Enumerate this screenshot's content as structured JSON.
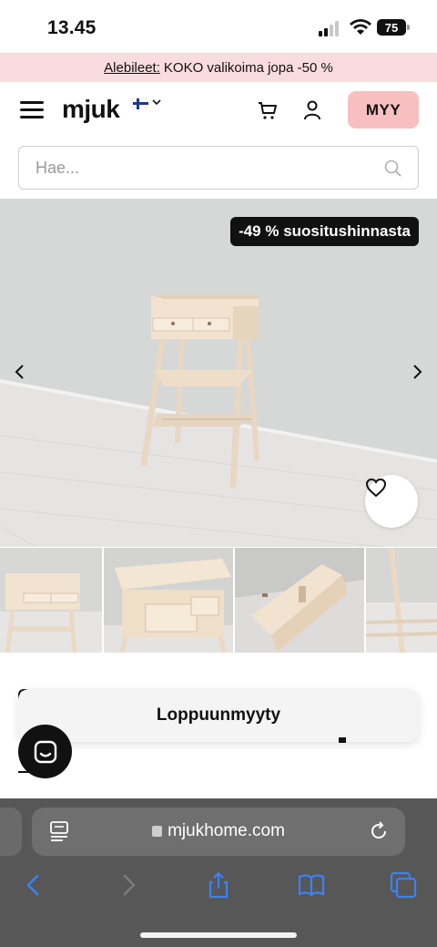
{
  "status_bar": {
    "time": "13.45",
    "battery": "75"
  },
  "promo": {
    "link_label": "Alebileet:",
    "text": "KOKO valikoima jopa -50 %"
  },
  "header": {
    "logo": "mjuk",
    "sell_label": "MYY"
  },
  "search": {
    "placeholder": "Hae..."
  },
  "product": {
    "discount_badge": "-49 % suositushinnasta",
    "sold_out_label": "Loppuunmyyty",
    "image_count_visible": 4
  },
  "browser": {
    "url": "mjukhome.com"
  },
  "colors": {
    "promo_bg": "#f9dcdd",
    "sell_button_bg": "#f7bfc0",
    "badge_bg": "#111111",
    "browser_bar_bg": "#575757",
    "browser_accent": "#3a82f7"
  },
  "icons": [
    "hamburger-icon",
    "flag-fi-icon",
    "chevron-down-icon",
    "cart-icon",
    "user-icon",
    "search-icon",
    "chevron-left-icon",
    "chevron-right-icon",
    "heart-icon",
    "chat-icon",
    "reader-icon",
    "lock-icon",
    "reload-icon",
    "back-icon",
    "forward-icon",
    "share-icon",
    "bookmarks-icon",
    "tabs-icon"
  ]
}
